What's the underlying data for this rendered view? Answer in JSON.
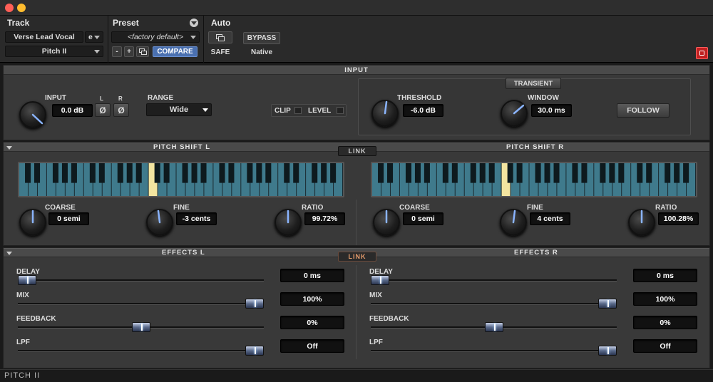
{
  "window": {
    "title": ""
  },
  "header": {
    "track_label": "Track",
    "track_name": "Verse Lead Vocal",
    "track_group": "e",
    "insert_name": "Pitch II",
    "preset_label": "Preset",
    "preset_name": "<factory default>",
    "minus": "-",
    "plus": "+",
    "compare": "COMPARE",
    "auto_label": "Auto",
    "safe": "SAFE",
    "bypass": "BYPASS",
    "native": "Native"
  },
  "input": {
    "section": "INPUT",
    "input_label": "INPUT",
    "input_value": "0.0 dB",
    "l_label": "L",
    "r_label": "R",
    "phase_symbol": "Ø",
    "range_label": "RANGE",
    "range_value": "Wide",
    "clip": "CLIP",
    "level": "LEVEL",
    "transient": "TRANSIENT",
    "threshold_label": "THRESHOLD",
    "threshold_value": "-6.0 dB",
    "window_label": "WINDOW",
    "window_value": "30.0 ms",
    "follow": "FOLLOW"
  },
  "pitch": {
    "left_title": "PITCH SHIFT L",
    "right_title": "PITCH SHIFT R",
    "link": "LINK",
    "left": {
      "coarse_label": "COARSE",
      "coarse": "0 semi",
      "fine_label": "FINE",
      "fine": "-3 cents",
      "ratio_label": "RATIO",
      "ratio": "99.72%"
    },
    "right": {
      "coarse_label": "COARSE",
      "coarse": "0 semi",
      "fine_label": "FINE",
      "fine": "4 cents",
      "ratio_label": "RATIO",
      "ratio": "100.28%"
    }
  },
  "effects": {
    "left_title": "EFFECTS L",
    "right_title": "EFFECTS R",
    "link": "LINK",
    "left": {
      "delay_label": "DELAY",
      "delay": "0 ms",
      "delay_pos": 0,
      "mix_label": "MIX",
      "mix": "100%",
      "mix_pos": 1,
      "feedback_label": "FEEDBACK",
      "feedback": "0%",
      "feedback_pos": 0.5,
      "lpf_label": "LPF",
      "lpf": "Off",
      "lpf_pos": 1
    },
    "right": {
      "delay_label": "DELAY",
      "delay": "0 ms",
      "delay_pos": 0,
      "mix_label": "MIX",
      "mix": "100%",
      "mix_pos": 1,
      "feedback_label": "FEEDBACK",
      "feedback": "0%",
      "feedback_pos": 0.5,
      "lpf_label": "LPF",
      "lpf": "Off",
      "lpf_pos": 1
    }
  },
  "footer": {
    "plugin_name": "PITCH II"
  },
  "colors": {
    "accent": "#4a7fd0",
    "keyboard_highlight": "#f3e5a0",
    "link_active": "#e39a6a",
    "close_red": "#e03030"
  }
}
